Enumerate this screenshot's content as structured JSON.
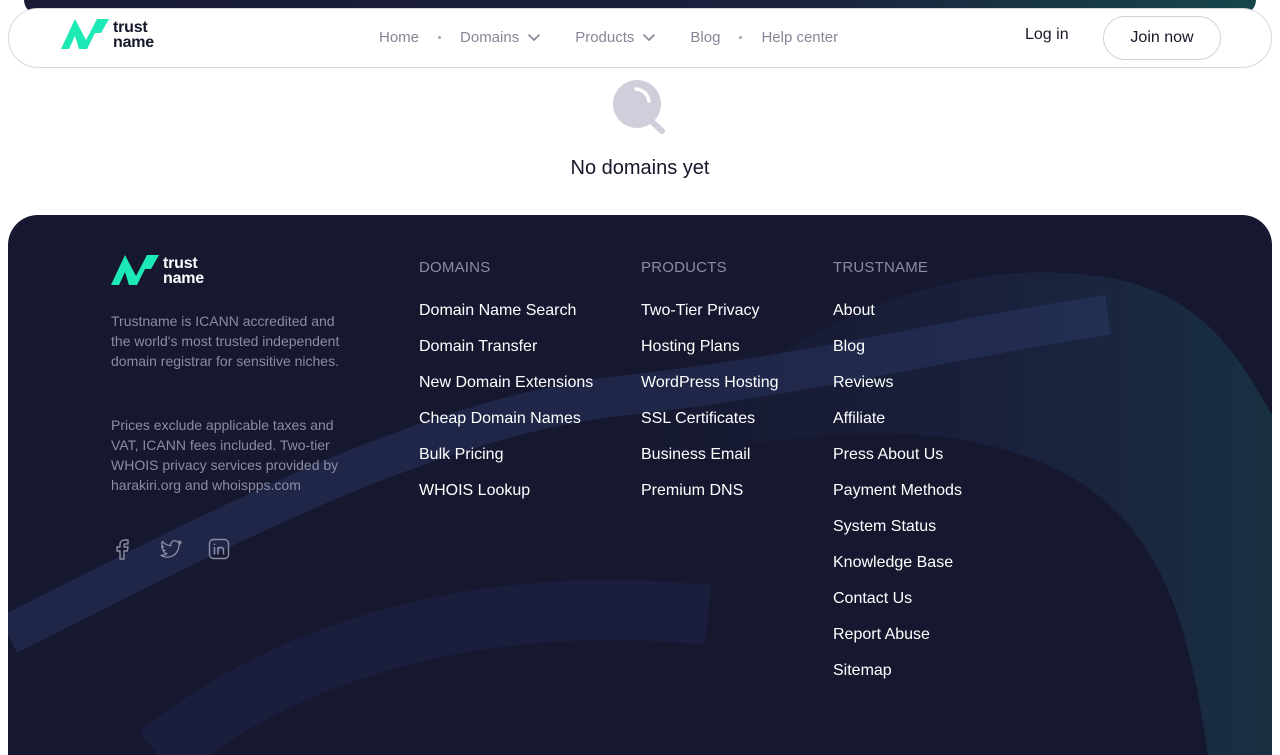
{
  "brand": {
    "line1": "trust",
    "line2": "name",
    "accent": "#1de9b6"
  },
  "nav": {
    "links": [
      "Home",
      "Domains",
      "Products",
      "Blog",
      "Help center"
    ],
    "login": "Log in",
    "join": "Join now"
  },
  "empty_state": {
    "icon": "search-icon",
    "message": "No domains yet"
  },
  "footer": {
    "description": "Trustname is ICANN accredited and the world's most trusted independent domain registrar for sensitive niches.",
    "prices_note": "Prices exclude applicable taxes and VAT, ICANN fees included. Two-tier WHOIS privacy services provided by harakiri.org and whoispps.com",
    "socials": [
      "facebook-icon",
      "twitter-icon",
      "linkedin-icon"
    ],
    "columns": [
      {
        "title": "DOMAINS",
        "items": [
          "Domain Name Search",
          "Domain Transfer",
          "New Domain Extensions",
          "Cheap Domain Names",
          "Bulk Pricing",
          "WHOIS Lookup"
        ]
      },
      {
        "title": "PRODUCTS",
        "items": [
          "Two-Tier Privacy",
          "Hosting Plans",
          "WordPress Hosting",
          "SSL Certificates",
          "Business Email",
          "Premium DNS"
        ]
      },
      {
        "title": "TRUSTNAME",
        "items": [
          "About",
          "Blog",
          "Reviews",
          "Affiliate",
          "Press About Us",
          "Payment Methods",
          "System Status",
          "Knowledge Base",
          "Contact Us",
          "Report Abuse",
          "Sitemap"
        ]
      }
    ]
  },
  "colors": {
    "footer_bg": "#161830",
    "text_dark": "#15172b",
    "muted": "#868699"
  }
}
